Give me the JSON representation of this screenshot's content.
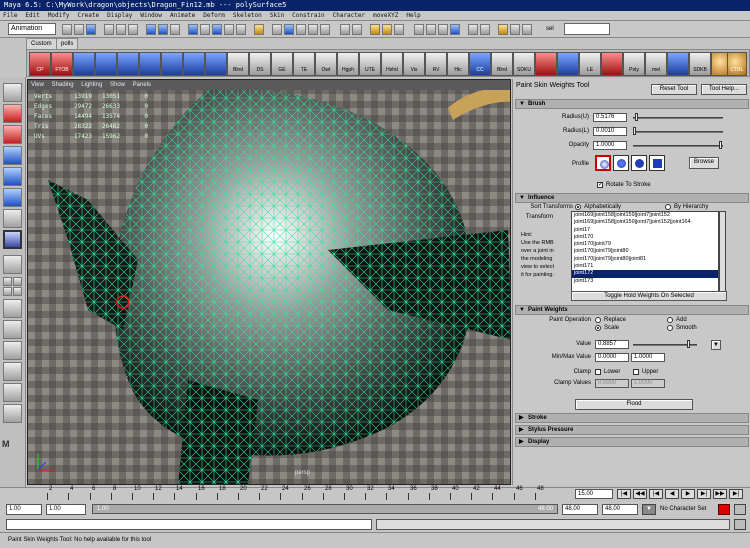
{
  "window": {
    "title": "Maya 6.5: C:\\MyWork\\dragon\\objects\\Dragon_Fin12.mb   ---   polySurface5"
  },
  "menu": [
    "File",
    "Edit",
    "Modify",
    "Create",
    "Display",
    "Window",
    "Animate",
    "Deform",
    "Skeleton",
    "Skin",
    "Constrain",
    "Character",
    "moveXYZ",
    "Help"
  ],
  "status_line": {
    "mode_selector": "Animation",
    "sel_label": "sel"
  },
  "shelf": {
    "tabs": [
      "Custom",
      "polls"
    ],
    "buttons": [
      "CP",
      "FTOB",
      "",
      "",
      "",
      "",
      "",
      "",
      "",
      "",
      "Blnd",
      "DS",
      "GE",
      "TE",
      "Owt",
      "Hgph",
      "UTE",
      "Hshd",
      "Vis",
      "RV",
      "Hic",
      "CC",
      "Blnd",
      "SDKU",
      "",
      "",
      "LE",
      "",
      "Poly Tools",
      "mel",
      "",
      "SDKB",
      "",
      "CTRL",
      "TOOL"
    ]
  },
  "viewport": {
    "menus": [
      "View",
      "Shading",
      "Lighting",
      "Show",
      "Panels"
    ],
    "hud": [
      {
        "label": "Verts",
        "a": "13919",
        "b": "13051",
        "c": "0"
      },
      {
        "label": "Edges",
        "a": "29472",
        "b": "26633",
        "c": "0"
      },
      {
        "label": "Faces",
        "a": "14494",
        "b": "13574",
        "c": "0"
      },
      {
        "label": "Tris",
        "a": "28322",
        "b": "26482",
        "c": "0"
      },
      {
        "label": "UVs",
        "a": "17423",
        "b": "15962",
        "c": "0"
      }
    ],
    "camera": "persp"
  },
  "tool_settings": {
    "title": "Paint Skin Weights Tool",
    "reset_label": "Reset Tool",
    "help_label": "Tool Help...",
    "brush": {
      "header": "Brush",
      "radius_u_label": "Radius(U)",
      "radius_u": "0.5176",
      "radius_l_label": "Radius(L)",
      "radius_l": "0.0010",
      "opacity_label": "Opacity",
      "opacity": "1.0000",
      "profile_label": "Profile",
      "browse_label": "Browse",
      "rotate_label": "Rotate To Stroke"
    },
    "influence": {
      "header": "Influence",
      "sort_label": "Sort Transforms",
      "sort_opt1": "Alphabetically",
      "sort_opt2": "By Hierarchy",
      "transforms_label": "Transform",
      "hint": [
        "Hint:",
        "Use the RMB",
        "over a joint in",
        "the modeling",
        "view to select",
        "it for painting."
      ],
      "joints": [
        "joint169|joint158|joint159|joint7|joint152",
        "joint169|joint158|joint159|joint7|joint152|joint164",
        "joint17",
        "joint170",
        "joint170|joint79",
        "joint170|joint79|joint80",
        "joint170|joint79|joint80|joint81",
        "joint171",
        "joint172",
        "joint173"
      ],
      "selected_index": 8,
      "toggle_label": "Toggle Hold Weights On Selected"
    },
    "paint_weights": {
      "header": "Paint Weights",
      "operation_label": "Paint Operation",
      "op_replace": "Replace",
      "op_add": "Add",
      "op_scale": "Scale",
      "op_smooth": "Smooth",
      "value_label": "Value",
      "value": "0.8857",
      "minmax_label": "Min/Max Value",
      "min": "0.0000",
      "max": "1.0000",
      "clamp_label": "Clamp",
      "clamp_lower": "Lower",
      "clamp_upper": "Upper",
      "clamp_values_label": "Clamp Values",
      "clamp_min": "0.0000",
      "clamp_max": "1.0000",
      "flood_label": "Flood"
    },
    "collapsed": [
      "Stroke",
      "Stylus Pressure",
      "Display"
    ]
  },
  "timeline": {
    "ticks": [
      "2",
      "4",
      "6",
      "8",
      "10",
      "12",
      "14",
      "16",
      "18",
      "20",
      "22",
      "24",
      "26",
      "28",
      "30",
      "32",
      "34",
      "36",
      "38",
      "40",
      "42",
      "44",
      "46",
      "48"
    ],
    "current_frame": "15.00"
  },
  "range": {
    "start": "1.00",
    "inner_start": "1.00",
    "inner_end": "48.00",
    "slider_left": "1.00",
    "slider_right": "48.00",
    "end": "48.00",
    "character_set": "No Character Set"
  },
  "help_line": "Paint Skin Weights Tool: No help available for this tool"
}
